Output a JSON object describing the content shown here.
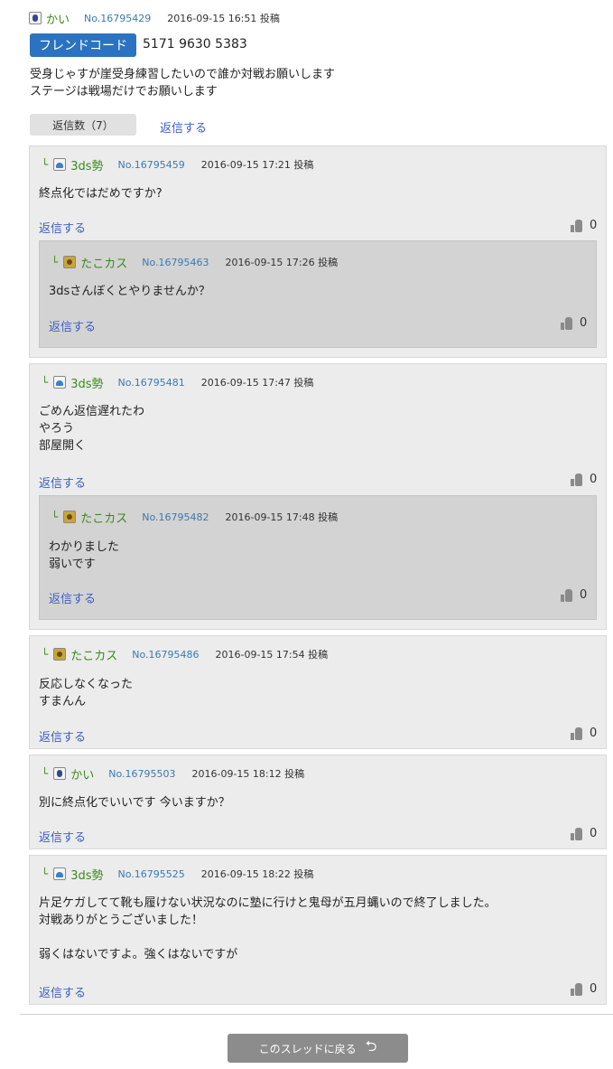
{
  "op": {
    "user": "かい",
    "no": "No.16795429",
    "date": "2016-09-15 16:51 投稿",
    "friend_code_label": "フレンドコード",
    "friend_code": "5171 9630 5383",
    "body": "受身じゃすが崖受身練習したいので誰か対戦お願いします\nステージは戦場だけでお願いします",
    "reply_count_label": "返信数（7）",
    "reply_label": "返信する"
  },
  "replies": [
    {
      "user": "3ds勢",
      "icon": "ds-icon",
      "no": "No.16795459",
      "date": "2016-09-15 17:21 投稿",
      "body": "終点化ではだめですか?",
      "reply_label": "返信する",
      "likes": "0",
      "child": {
        "user": "たこカス",
        "icon": "tako-icon",
        "no": "No.16795463",
        "date": "2016-09-15 17:26 投稿",
        "body": "3dsさんぼくとやりませんか？",
        "reply_label": "返信する",
        "likes": "0"
      }
    },
    {
      "user": "3ds勢",
      "icon": "ds-icon",
      "no": "No.16795481",
      "date": "2016-09-15 17:47 投稿",
      "body": "ごめん返信遅れたわ\nやろう\n部屋開く",
      "reply_label": "返信する",
      "likes": "0",
      "child": {
        "user": "たこカス",
        "icon": "tako-icon",
        "no": "No.16795482",
        "date": "2016-09-15 17:48 投稿",
        "body": "わかりました\n弱いです",
        "reply_label": "返信する",
        "likes": "0"
      }
    },
    {
      "user": "たこカス",
      "icon": "tako-icon",
      "no": "No.16795486",
      "date": "2016-09-15 17:54 投稿",
      "body": "反応しなくなった\nすまんん",
      "reply_label": "返信する",
      "likes": "0"
    },
    {
      "user": "かい",
      "icon": "kai-icon",
      "no": "No.16795503",
      "date": "2016-09-15 18:12 投稿",
      "body": "別に終点化でいいです 今いますか？",
      "reply_label": "返信する",
      "likes": "0"
    },
    {
      "user": "3ds勢",
      "icon": "ds-icon",
      "no": "No.16795525",
      "date": "2016-09-15 18:22 投稿",
      "body": "片足ケガしてて靴も履けない状況なのに塾に行けと鬼母が五月蝿いので終了しました。\n対戦ありがとうございました！\n\n弱くはないですよ。強くはないですが",
      "reply_label": "返信する",
      "likes": "0"
    }
  ],
  "tree_mark": "└",
  "back_button": "このスレッドに戻る",
  "back_arrow": "⮌"
}
